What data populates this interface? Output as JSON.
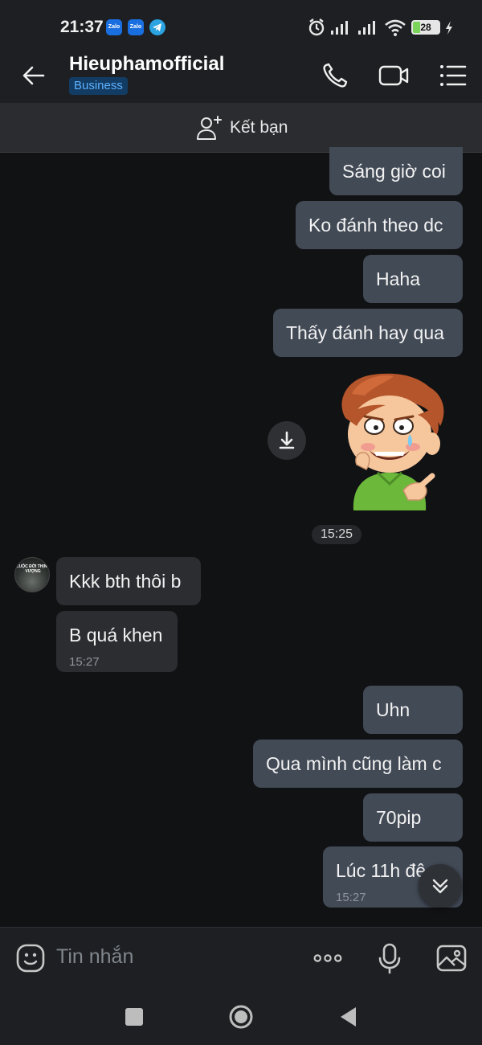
{
  "status_bar": {
    "time": "21:37",
    "app_icons": [
      "Zalo",
      "Zalo",
      "telegram-icon"
    ],
    "battery": "28",
    "icons": [
      "alarm-icon",
      "signal-icon",
      "signal-icon",
      "wifi-icon",
      "battery-icon",
      "charging-icon"
    ]
  },
  "header": {
    "name": "Hieuphamofficial",
    "badge": "Business",
    "icons": [
      "back-arrow-icon",
      "phone-icon",
      "video-call-icon",
      "menu-list-icon"
    ]
  },
  "friend_bar": {
    "label": "Kết bạn",
    "icon": "add-person-icon"
  },
  "messages": [
    {
      "dir": "out",
      "text": "Sáng giờ coi"
    },
    {
      "dir": "out",
      "text": "Ko đánh theo dc"
    },
    {
      "dir": "out",
      "text": "Haha"
    },
    {
      "dir": "out",
      "text": "Thấy đánh hay qua"
    },
    {
      "dir": "out",
      "type": "sticker"
    },
    {
      "type": "time",
      "text": "15:25"
    },
    {
      "dir": "in",
      "text": "Kkk bth thôi b"
    },
    {
      "dir": "in",
      "text": "B quá khen",
      "time": "15:27"
    },
    {
      "dir": "out",
      "text": "Uhn"
    },
    {
      "dir": "out",
      "text": "Qua mình cũng làm c"
    },
    {
      "dir": "out",
      "text": "70pip"
    },
    {
      "dir": "out",
      "text": "Lúc 11h đê",
      "time": "15:27"
    }
  ],
  "avatar_text": "CUỘC ĐỜI THỊNH VƯỢNG",
  "input": {
    "placeholder": "Tin nhắn",
    "icons": [
      "sticker-icon",
      "more-icon",
      "microphone-icon",
      "image-icon"
    ]
  },
  "colors": {
    "background": "#111214",
    "bar": "#1d1f22",
    "bubble_out": "#424a56",
    "bubble_in": "#2c2d31",
    "badge_bg": "#123c63",
    "badge_text": "#5fb0ff"
  }
}
